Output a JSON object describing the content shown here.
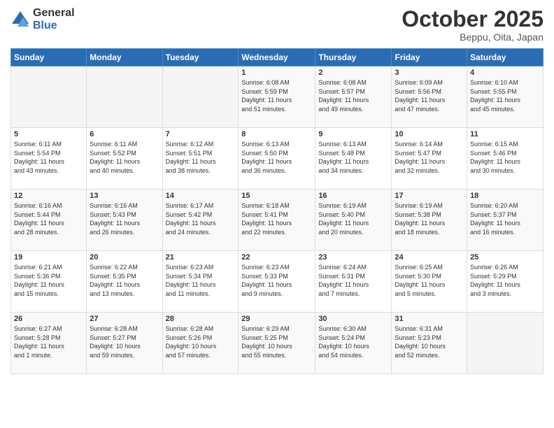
{
  "logo": {
    "general": "General",
    "blue": "Blue"
  },
  "header": {
    "title": "October 2025",
    "location": "Beppu, Oita, Japan"
  },
  "weekdays": [
    "Sunday",
    "Monday",
    "Tuesday",
    "Wednesday",
    "Thursday",
    "Friday",
    "Saturday"
  ],
  "weeks": [
    [
      {
        "day": "",
        "info": ""
      },
      {
        "day": "",
        "info": ""
      },
      {
        "day": "",
        "info": ""
      },
      {
        "day": "1",
        "info": "Sunrise: 6:08 AM\nSunset: 5:59 PM\nDaylight: 11 hours\nand 51 minutes."
      },
      {
        "day": "2",
        "info": "Sunrise: 6:08 AM\nSunset: 5:57 PM\nDaylight: 11 hours\nand 49 minutes."
      },
      {
        "day": "3",
        "info": "Sunrise: 6:09 AM\nSunset: 5:56 PM\nDaylight: 11 hours\nand 47 minutes."
      },
      {
        "day": "4",
        "info": "Sunrise: 6:10 AM\nSunset: 5:55 PM\nDaylight: 11 hours\nand 45 minutes."
      }
    ],
    [
      {
        "day": "5",
        "info": "Sunrise: 6:11 AM\nSunset: 5:54 PM\nDaylight: 11 hours\nand 43 minutes."
      },
      {
        "day": "6",
        "info": "Sunrise: 6:11 AM\nSunset: 5:52 PM\nDaylight: 11 hours\nand 40 minutes."
      },
      {
        "day": "7",
        "info": "Sunrise: 6:12 AM\nSunset: 5:51 PM\nDaylight: 11 hours\nand 38 minutes."
      },
      {
        "day": "8",
        "info": "Sunrise: 6:13 AM\nSunset: 5:50 PM\nDaylight: 11 hours\nand 36 minutes."
      },
      {
        "day": "9",
        "info": "Sunrise: 6:13 AM\nSunset: 5:48 PM\nDaylight: 11 hours\nand 34 minutes."
      },
      {
        "day": "10",
        "info": "Sunrise: 6:14 AM\nSunset: 5:47 PM\nDaylight: 11 hours\nand 32 minutes."
      },
      {
        "day": "11",
        "info": "Sunrise: 6:15 AM\nSunset: 5:46 PM\nDaylight: 11 hours\nand 30 minutes."
      }
    ],
    [
      {
        "day": "12",
        "info": "Sunrise: 6:16 AM\nSunset: 5:44 PM\nDaylight: 11 hours\nand 28 minutes."
      },
      {
        "day": "13",
        "info": "Sunrise: 6:16 AM\nSunset: 5:43 PM\nDaylight: 11 hours\nand 26 minutes."
      },
      {
        "day": "14",
        "info": "Sunrise: 6:17 AM\nSunset: 5:42 PM\nDaylight: 11 hours\nand 24 minutes."
      },
      {
        "day": "15",
        "info": "Sunrise: 6:18 AM\nSunset: 5:41 PM\nDaylight: 11 hours\nand 22 minutes."
      },
      {
        "day": "16",
        "info": "Sunrise: 6:19 AM\nSunset: 5:40 PM\nDaylight: 11 hours\nand 20 minutes."
      },
      {
        "day": "17",
        "info": "Sunrise: 6:19 AM\nSunset: 5:38 PM\nDaylight: 11 hours\nand 18 minutes."
      },
      {
        "day": "18",
        "info": "Sunrise: 6:20 AM\nSunset: 5:37 PM\nDaylight: 11 hours\nand 16 minutes."
      }
    ],
    [
      {
        "day": "19",
        "info": "Sunrise: 6:21 AM\nSunset: 5:36 PM\nDaylight: 11 hours\nand 15 minutes."
      },
      {
        "day": "20",
        "info": "Sunrise: 6:22 AM\nSunset: 5:35 PM\nDaylight: 11 hours\nand 13 minutes."
      },
      {
        "day": "21",
        "info": "Sunrise: 6:23 AM\nSunset: 5:34 PM\nDaylight: 11 hours\nand 11 minutes."
      },
      {
        "day": "22",
        "info": "Sunrise: 6:23 AM\nSunset: 5:33 PM\nDaylight: 11 hours\nand 9 minutes."
      },
      {
        "day": "23",
        "info": "Sunrise: 6:24 AM\nSunset: 5:31 PM\nDaylight: 11 hours\nand 7 minutes."
      },
      {
        "day": "24",
        "info": "Sunrise: 6:25 AM\nSunset: 5:30 PM\nDaylight: 11 hours\nand 5 minutes."
      },
      {
        "day": "25",
        "info": "Sunrise: 6:26 AM\nSunset: 5:29 PM\nDaylight: 11 hours\nand 3 minutes."
      }
    ],
    [
      {
        "day": "26",
        "info": "Sunrise: 6:27 AM\nSunset: 5:28 PM\nDaylight: 11 hours\nand 1 minute."
      },
      {
        "day": "27",
        "info": "Sunrise: 6:28 AM\nSunset: 5:27 PM\nDaylight: 10 hours\nand 59 minutes."
      },
      {
        "day": "28",
        "info": "Sunrise: 6:28 AM\nSunset: 5:26 PM\nDaylight: 10 hours\nand 57 minutes."
      },
      {
        "day": "29",
        "info": "Sunrise: 6:29 AM\nSunset: 5:25 PM\nDaylight: 10 hours\nand 55 minutes."
      },
      {
        "day": "30",
        "info": "Sunrise: 6:30 AM\nSunset: 5:24 PM\nDaylight: 10 hours\nand 54 minutes."
      },
      {
        "day": "31",
        "info": "Sunrise: 6:31 AM\nSunset: 5:23 PM\nDaylight: 10 hours\nand 52 minutes."
      },
      {
        "day": "",
        "info": ""
      }
    ]
  ]
}
